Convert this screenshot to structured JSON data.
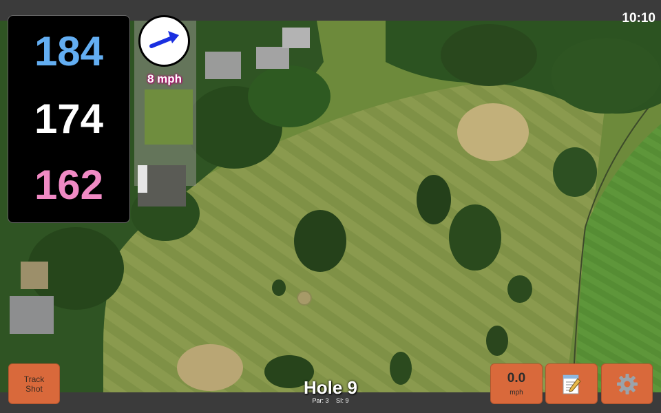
{
  "status_bar": {
    "time": "10:10"
  },
  "distances": {
    "back": "184",
    "middle": "174",
    "front": "162"
  },
  "wind": {
    "speed_label": "8 mph",
    "arrow_color": "#1a2fe0"
  },
  "hole": {
    "title": "Hole 9",
    "par_label": "Par: 3",
    "si_label": "SI: 9"
  },
  "buttons": {
    "track_shot_line1": "Track",
    "track_shot_line2": "Shot",
    "speed_value": "0.0",
    "speed_unit": "mph",
    "notes_icon": "notepad-icon",
    "settings_icon": "gear-icon"
  },
  "colors": {
    "back_distance": "#63aef2",
    "middle_distance": "#ffffff",
    "front_distance": "#f08ac4",
    "button": "#d9693b"
  }
}
